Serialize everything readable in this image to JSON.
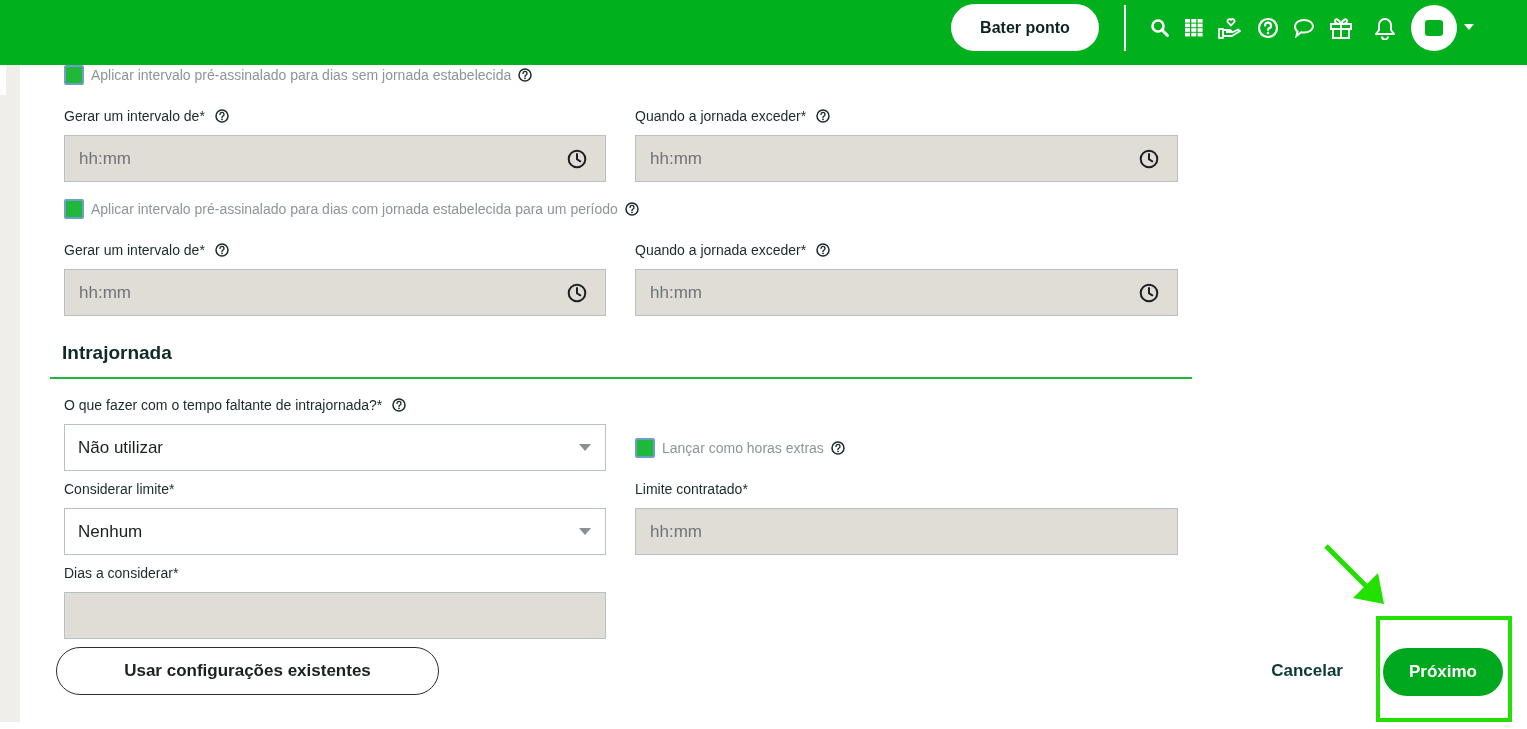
{
  "header": {
    "clock_button": "Bater ponto"
  },
  "interval_groups": [
    {
      "checkbox": {
        "label": "Aplicar intervalo pré-assinalado para dias sem jornada estabelecida",
        "checked": true
      },
      "fields": [
        {
          "label": "Gerar um intervalo de*",
          "help": true,
          "placeholder": "hh:mm"
        },
        {
          "label": "Quando a jornada exceder*",
          "help": true,
          "placeholder": "hh:mm"
        }
      ]
    },
    {
      "checkbox": {
        "label": "Aplicar intervalo pré-assinalado para dias com jornada estabelecida para um período",
        "checked": true
      },
      "fields": [
        {
          "label": "Gerar um intervalo de*",
          "help": true,
          "placeholder": "hh:mm"
        },
        {
          "label": "Quando a jornada exceder*",
          "help": true,
          "placeholder": "hh:mm"
        }
      ]
    }
  ],
  "intrajornada": {
    "title": "Intrajornada",
    "question": "O que fazer com o tempo faltante de intrajornada?*",
    "missing_time_select": "Não utilizar",
    "overtime_checkbox": {
      "label": "Lançar como horas extras",
      "checked": true
    },
    "limit_label": "Considerar limite*",
    "limit_select": "Nenhum",
    "contract_label": "Limite contratado*",
    "contract_placeholder": "hh:mm",
    "days_label": "Dias a considerar*"
  },
  "footer": {
    "existing_button": "Usar configurações existentes",
    "cancel": "Cancelar",
    "next": "Próximo"
  }
}
